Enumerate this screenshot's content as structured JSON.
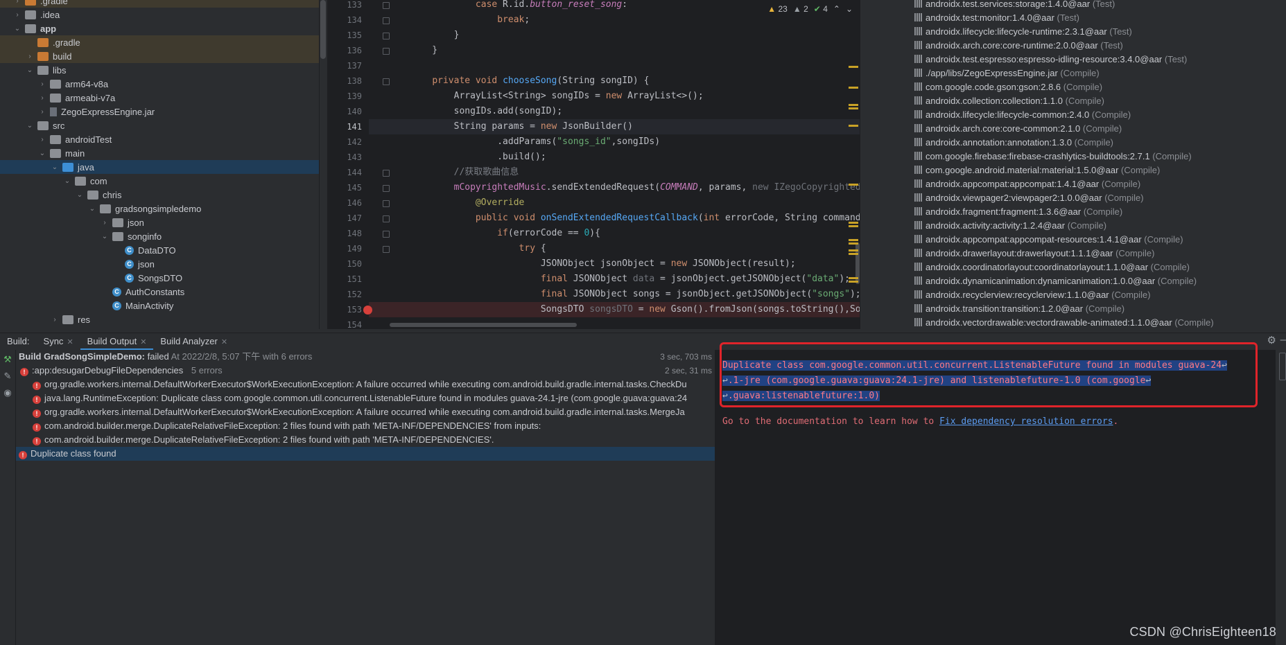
{
  "project_tree": [
    {
      "label": ".gradle",
      "depth": 1,
      "chev": "right",
      "icon": "orange",
      "state": "excluded"
    },
    {
      "label": ".idea",
      "depth": 1,
      "chev": "right",
      "icon": "gray"
    },
    {
      "label": "app",
      "depth": 1,
      "chev": "down",
      "icon": "gray",
      "bold": true
    },
    {
      "label": ".gradle",
      "depth": 2,
      "chev": "",
      "icon": "orange",
      "state": "excluded"
    },
    {
      "label": "build",
      "depth": 2,
      "chev": "right",
      "icon": "orange",
      "state": "excluded"
    },
    {
      "label": "libs",
      "depth": 2,
      "chev": "down",
      "icon": "gray"
    },
    {
      "label": "arm64-v8a",
      "depth": 3,
      "chev": "right",
      "icon": "gray"
    },
    {
      "label": "armeabi-v7a",
      "depth": 3,
      "chev": "right",
      "icon": "gray"
    },
    {
      "label": "ZegoExpressEngine.jar",
      "depth": 3,
      "chev": "right",
      "icon": "jar"
    },
    {
      "label": "src",
      "depth": 2,
      "chev": "down",
      "icon": "gray"
    },
    {
      "label": "androidTest",
      "depth": 3,
      "chev": "right",
      "icon": "gray"
    },
    {
      "label": "main",
      "depth": 3,
      "chev": "down",
      "icon": "gray"
    },
    {
      "label": "java",
      "depth": 4,
      "chev": "down",
      "icon": "blue",
      "state": "selected"
    },
    {
      "label": "com",
      "depth": 5,
      "chev": "down",
      "icon": "gray"
    },
    {
      "label": "chris",
      "depth": 6,
      "chev": "down",
      "icon": "gray"
    },
    {
      "label": "gradsongsimpledemo",
      "depth": 7,
      "chev": "down",
      "icon": "gray"
    },
    {
      "label": "json",
      "depth": 8,
      "chev": "right",
      "icon": "gray"
    },
    {
      "label": "songinfo",
      "depth": 8,
      "chev": "down",
      "icon": "gray"
    },
    {
      "label": "DataDTO",
      "depth": 9,
      "chev": "",
      "icon": "class"
    },
    {
      "label": "json",
      "depth": 9,
      "chev": "",
      "icon": "class"
    },
    {
      "label": "SongsDTO",
      "depth": 9,
      "chev": "",
      "icon": "class"
    },
    {
      "label": "AuthConstants",
      "depth": 8,
      "chev": "",
      "icon": "class"
    },
    {
      "label": "MainActivity",
      "depth": 8,
      "chev": "",
      "icon": "class"
    },
    {
      "label": "res",
      "depth": 4,
      "chev": "right",
      "icon": "gray"
    }
  ],
  "editor": {
    "inspections": {
      "warnings": "23",
      "weak_warnings": "2",
      "typos": "4"
    },
    "current_line": "141",
    "breakpoint_line": "153",
    "lines": [
      {
        "n": "133",
        "html": "            <span class='kw'>case</span> R.id.<span class='ital'>button_reset_song</span>:"
      },
      {
        "n": "134",
        "html": "                <span class='kw'>break</span>;"
      },
      {
        "n": "135",
        "html": "        }"
      },
      {
        "n": "136",
        "html": "    }"
      },
      {
        "n": "137",
        "html": ""
      },
      {
        "n": "138",
        "html": "    <span class='kw'>private void</span> <span class='fn'>chooseSong</span>(String songID) {"
      },
      {
        "n": "139",
        "html": "        ArrayList&lt;String&gt; songIDs = <span class='kw'>new</span> ArrayList&lt;&gt;();"
      },
      {
        "n": "140",
        "html": "        songIDs.add(songID);"
      },
      {
        "n": "141",
        "html": "        String params = <span class='kw'>new</span> JsonBuilder()"
      },
      {
        "n": "142",
        "html": "                .addParams(<span class='str'>\"songs_id\"</span>,songIDs)"
      },
      {
        "n": "143",
        "html": "                .build();"
      },
      {
        "n": "144",
        "html": "        <span class='cm'>//获取歌曲信息</span>"
      },
      {
        "n": "145",
        "html": "        <span class='fld'>mCopyrightedMusic</span>.sendExtendedRequest(<span class='ital'>COMMAND</span>, params, <span class='gray'>new IZegoCopyrightedMu</span>"
      },
      {
        "n": "146",
        "html": "            <span class='ann'>@Override</span>"
      },
      {
        "n": "147",
        "html": "            <span class='kw'>public void</span> <span class='fn'>onSendExtendedRequestCallback</span>(<span class='kw'>int</span> errorCode, String command,"
      },
      {
        "n": "148",
        "html": "                <span class='kw'>if</span>(errorCode == <span class='num'>0</span>){"
      },
      {
        "n": "149",
        "html": "                    <span class='kw'>try</span> {"
      },
      {
        "n": "150",
        "html": "                        JSONObject jsonObject = <span class='kw'>new</span> JSONObject(result);"
      },
      {
        "n": "151",
        "html": "                        <span class='kw'>final</span> JSONObject <span class='gray'>data</span> = jsonObject.getJSONObject(<span class='str'>\"data\"</span>);"
      },
      {
        "n": "152",
        "html": "                        <span class='kw'>final</span> JSONObject songs = jsonObject.getJSONObject(<span class='str'>\"songs\"</span>);"
      },
      {
        "n": "153",
        "html": "                        SongsDTO <span class='gray'>songsDTO</span> = <span class='kw'>new</span> Gson().fromJson(songs.toString(),Song"
      },
      {
        "n": "154",
        "html": ""
      }
    ]
  },
  "dependencies": [
    {
      "name": "androidx.test.services:storage:1.4.0@aar",
      "scope": "(Test)"
    },
    {
      "name": "androidx.test:monitor:1.4.0@aar",
      "scope": "(Test)"
    },
    {
      "name": "androidx.lifecycle:lifecycle-runtime:2.3.1@aar",
      "scope": "(Test)"
    },
    {
      "name": "androidx.arch.core:core-runtime:2.0.0@aar",
      "scope": "(Test)"
    },
    {
      "name": "androidx.test.espresso:espresso-idling-resource:3.4.0@aar",
      "scope": "(Test)"
    },
    {
      "name": "./app/libs/ZegoExpressEngine.jar",
      "scope": "(Compile)"
    },
    {
      "name": "com.google.code.gson:gson:2.8.6",
      "scope": "(Compile)"
    },
    {
      "name": "androidx.collection:collection:1.1.0",
      "scope": "(Compile)"
    },
    {
      "name": "androidx.lifecycle:lifecycle-common:2.4.0",
      "scope": "(Compile)"
    },
    {
      "name": "androidx.arch.core:core-common:2.1.0",
      "scope": "(Compile)"
    },
    {
      "name": "androidx.annotation:annotation:1.3.0",
      "scope": "(Compile)"
    },
    {
      "name": "com.google.firebase:firebase-crashlytics-buildtools:2.7.1",
      "scope": "(Compile)"
    },
    {
      "name": "com.google.android.material:material:1.5.0@aar",
      "scope": "(Compile)"
    },
    {
      "name": "androidx.appcompat:appcompat:1.4.1@aar",
      "scope": "(Compile)"
    },
    {
      "name": "androidx.viewpager2:viewpager2:1.0.0@aar",
      "scope": "(Compile)"
    },
    {
      "name": "androidx.fragment:fragment:1.3.6@aar",
      "scope": "(Compile)"
    },
    {
      "name": "androidx.activity:activity:1.2.4@aar",
      "scope": "(Compile)"
    },
    {
      "name": "androidx.appcompat:appcompat-resources:1.4.1@aar",
      "scope": "(Compile)"
    },
    {
      "name": "androidx.drawerlayout:drawerlayout:1.1.1@aar",
      "scope": "(Compile)"
    },
    {
      "name": "androidx.coordinatorlayout:coordinatorlayout:1.1.0@aar",
      "scope": "(Compile)"
    },
    {
      "name": "androidx.dynamicanimation:dynamicanimation:1.0.0@aar",
      "scope": "(Compile)"
    },
    {
      "name": "androidx.recyclerview:recyclerview:1.1.0@aar",
      "scope": "(Compile)"
    },
    {
      "name": "androidx.transition:transition:1.2.0@aar",
      "scope": "(Compile)"
    },
    {
      "name": "androidx.vectordrawable:vectordrawable-animated:1.1.0@aar",
      "scope": "(Compile)"
    }
  ],
  "build": {
    "label": "Build:",
    "tabs": [
      {
        "label": "Sync",
        "closable": true
      },
      {
        "label": "Build Output",
        "closable": true,
        "active": true
      },
      {
        "label": "Build Analyzer",
        "closable": true
      }
    ],
    "summary": {
      "title": "Build GradSongSimpleDemo:",
      "status": "failed",
      "when": "At 2022/2/8, 5:07 下午 with 6 errors",
      "time": "3 sec, 703 ms"
    },
    "task": {
      "name": ":app:desugarDebugFileDependencies",
      "count": "5 errors",
      "time": "2 sec, 31 ms"
    },
    "errors": [
      "org.gradle.workers.internal.DefaultWorkerExecutor$WorkExecutionException: A failure occurred while executing com.android.build.gradle.internal.tasks.CheckDu",
      "java.lang.RuntimeException: Duplicate class com.google.common.util.concurrent.ListenableFuture found in modules guava-24.1-jre (com.google.guava:guava:24",
      "org.gradle.workers.internal.DefaultWorkerExecutor$WorkExecutionException: A failure occurred while executing com.android.build.gradle.internal.tasks.MergeJa",
      "com.android.builder.merge.DuplicateRelativeFileException: 2 files found with path 'META-INF/DEPENDENCIES' from inputs:",
      "com.android.builder.merge.DuplicateRelativeFileException: 2 files found with path 'META-INF/DEPENDENCIES'."
    ],
    "selected_error": "Duplicate class found",
    "output": {
      "lines": [
        "Duplicate class com.google.common.util.concurrent.ListenableFuture found in modules guava-24",
        ".1-jre (com.google.guava:guava:24.1-jre) and listenablefuture-1.0 (com.google",
        ".guava:listenablefuture:1.0)"
      ],
      "wrap_mark": "↩",
      "doc_prefix": "Go to the documentation to learn how to ",
      "doc_link": "Fix dependency resolution errors",
      "doc_suffix": "."
    }
  },
  "watermark": "CSDN @ChrisEighteen18"
}
